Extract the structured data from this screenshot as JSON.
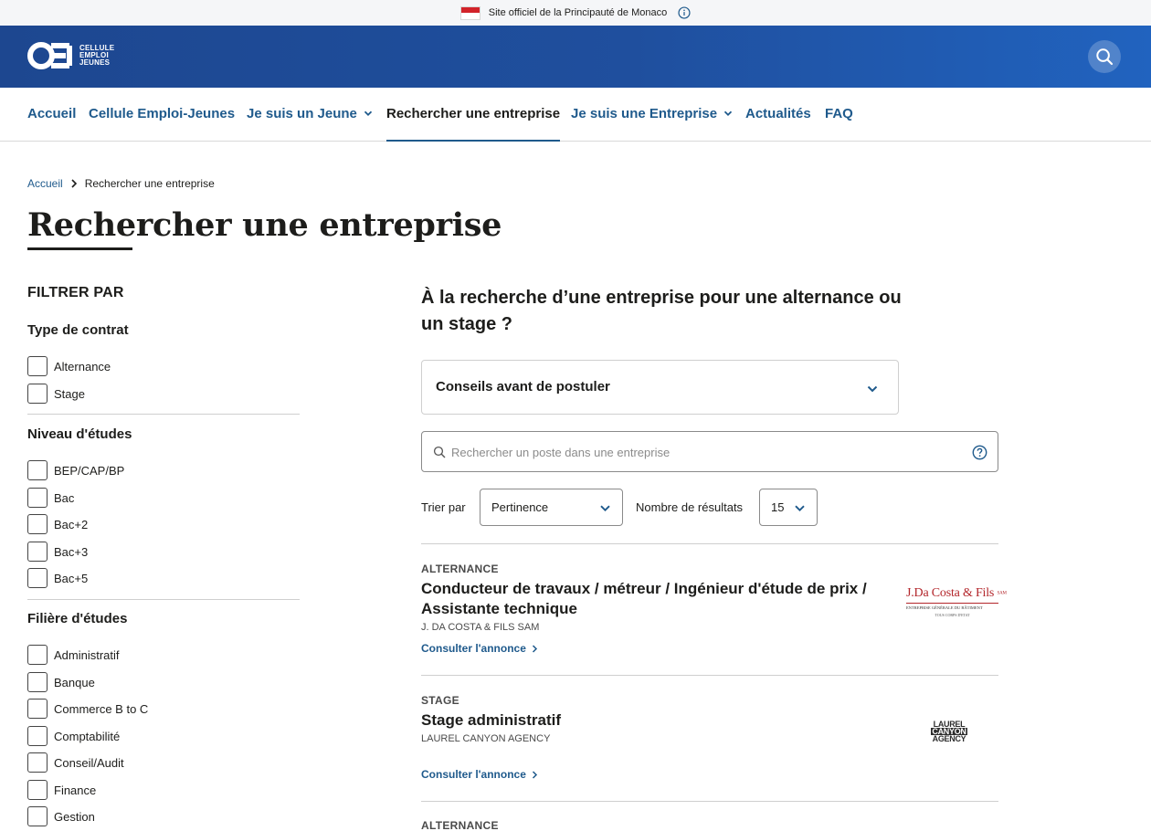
{
  "official_bar": {
    "text": "Site officiel de la Principauté de Monaco"
  },
  "header": {
    "logo_lines": [
      "CELLULE",
      "EMPLOI",
      "JEUNES"
    ]
  },
  "nav": {
    "items": [
      {
        "label": "Accueil"
      },
      {
        "label": "Cellule Emploi-Jeunes"
      },
      {
        "label": "Je suis un Jeune"
      },
      {
        "label": "Rechercher une entreprise"
      },
      {
        "label": "Je suis une Entreprise"
      },
      {
        "label": "Actualités"
      },
      {
        "label": "FAQ"
      }
    ],
    "active": "Rechercher une entreprise"
  },
  "breadcrumb": {
    "home": "Accueil",
    "current": "Rechercher une entreprise"
  },
  "page": {
    "title": "Rechercher une entreprise"
  },
  "filters": {
    "heading": "FILTRER PAR",
    "groups": [
      {
        "title": "Type de contrat",
        "options": [
          "Alternance",
          "Stage"
        ]
      },
      {
        "title": "Niveau d'études",
        "options": [
          "BEP/CAP/BP",
          "Bac",
          "Bac+2",
          "Bac+3",
          "Bac+5"
        ]
      },
      {
        "title": "Filière d'études",
        "options": [
          "Administratif",
          "Banque",
          "Commerce B to C",
          "Comptabilité",
          "Conseil/Audit",
          "Finance",
          "Gestion"
        ]
      }
    ]
  },
  "main": {
    "intro": "À la recherche d’une entreprise pour une alternance ou un stage ?",
    "accordion_label": "Conseils avant de postuler",
    "search_placeholder": "Rechercher un poste dans une entreprise",
    "sort_label": "Trier par",
    "sort_value": "Pertinence",
    "count_label": "Nombre de résultats",
    "count_value": "15"
  },
  "results": [
    {
      "type": "ALTERNANCE",
      "title": "Conducteur de travaux / métreur / Ingénieur d'étude de prix / Assistante technique",
      "company": "J. DA COSTA & FILS SAM",
      "link": "Consulter l'annonce",
      "logo": {
        "main": "J.Da Costa & Fils",
        "suffix": "SAM",
        "tagline": "ENTREPRISE GÉNÉRALE DU BÂTIMENT",
        "sub": "TOUS CORPS D'ETAT"
      }
    },
    {
      "type": "STAGE",
      "title": "Stage administratif",
      "company": "LAUREL CANYON AGENCY",
      "link": "Consulter l'annonce",
      "logo": {
        "lines": [
          "LAUREL",
          "CANYON",
          "AGENCY"
        ]
      }
    },
    {
      "type": "ALTERNANCE"
    }
  ],
  "colors": {
    "primary": "#1f5a8c",
    "header": "#1d4790",
    "text": "#1d1d1b"
  }
}
